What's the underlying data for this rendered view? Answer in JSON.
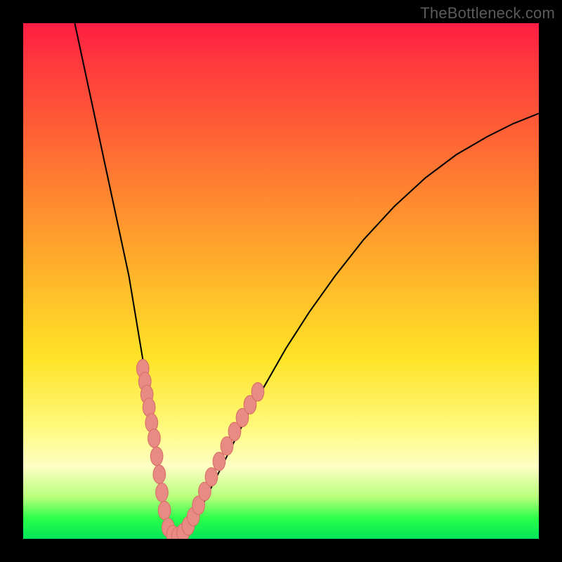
{
  "watermark": "TheBottleneck.com",
  "chart_data": {
    "type": "line",
    "title": "",
    "xlabel": "",
    "ylabel": "",
    "xlim": [
      0,
      100
    ],
    "ylim": [
      0,
      100
    ],
    "grid": false,
    "legend": false,
    "curve": {
      "stroke": "#000000",
      "width": 2,
      "points": [
        [
          10.0,
          100.0
        ],
        [
          11.5,
          93.0
        ],
        [
          13.0,
          86.0
        ],
        [
          14.5,
          79.0
        ],
        [
          16.0,
          72.0
        ],
        [
          17.5,
          65.0
        ],
        [
          19.0,
          58.0
        ],
        [
          20.5,
          51.0
        ],
        [
          21.5,
          45.0
        ],
        [
          22.5,
          39.0
        ],
        [
          23.5,
          33.0
        ],
        [
          24.5,
          27.0
        ],
        [
          25.3,
          21.0
        ],
        [
          26.0,
          15.0
        ],
        [
          26.6,
          10.0
        ],
        [
          27.2,
          6.0
        ],
        [
          27.8,
          3.0
        ],
        [
          28.4,
          1.3
        ],
        [
          29.0,
          0.6
        ],
        [
          29.7,
          0.3
        ],
        [
          30.5,
          0.5
        ],
        [
          31.3,
          1.0
        ],
        [
          32.2,
          2.0
        ],
        [
          33.2,
          3.5
        ],
        [
          34.5,
          6.0
        ],
        [
          36.0,
          9.0
        ],
        [
          38.0,
          13.0
        ],
        [
          40.5,
          18.0
        ],
        [
          43.5,
          24.0
        ],
        [
          47.0,
          30.0
        ],
        [
          51.0,
          37.0
        ],
        [
          55.5,
          44.0
        ],
        [
          60.5,
          51.0
        ],
        [
          66.0,
          58.0
        ],
        [
          72.0,
          64.5
        ],
        [
          78.0,
          70.0
        ],
        [
          84.0,
          74.5
        ],
        [
          90.0,
          78.0
        ],
        [
          95.0,
          80.5
        ],
        [
          100.0,
          82.5
        ]
      ]
    },
    "markers": {
      "color": "#e78b84",
      "stroke": "#d86f67",
      "rx": 1.2,
      "ry": 1.8,
      "points": [
        [
          23.2,
          33.0
        ],
        [
          23.6,
          30.5
        ],
        [
          24.0,
          28.0
        ],
        [
          24.4,
          25.5
        ],
        [
          24.9,
          22.5
        ],
        [
          25.4,
          19.5
        ],
        [
          25.9,
          16.0
        ],
        [
          26.4,
          12.5
        ],
        [
          26.9,
          9.0
        ],
        [
          27.4,
          5.5
        ],
        [
          28.1,
          2.2
        ],
        [
          29.0,
          0.8
        ],
        [
          30.0,
          0.5
        ],
        [
          31.0,
          1.2
        ],
        [
          32.0,
          2.5
        ],
        [
          33.0,
          4.3
        ],
        [
          34.0,
          6.5
        ],
        [
          35.2,
          9.2
        ],
        [
          36.5,
          12.0
        ],
        [
          38.0,
          15.0
        ],
        [
          39.5,
          18.0
        ],
        [
          41.0,
          20.8
        ],
        [
          42.5,
          23.5
        ],
        [
          44.0,
          26.0
        ],
        [
          45.5,
          28.5
        ]
      ]
    }
  }
}
